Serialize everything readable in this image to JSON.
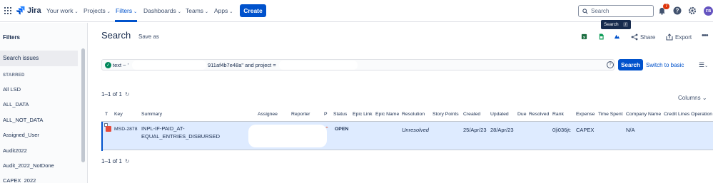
{
  "nav": {
    "logo": "Jira",
    "items": [
      {
        "label": "Your work"
      },
      {
        "label": "Projects"
      },
      {
        "label": "Filters"
      },
      {
        "label": "Dashboards"
      },
      {
        "label": "Teams"
      },
      {
        "label": "Apps"
      }
    ],
    "create": "Create",
    "search_placeholder": "Search",
    "tooltip": "Search",
    "tooltip_key": "/",
    "notifications": "7",
    "avatar": "FB"
  },
  "sidebar": {
    "title": "Filters",
    "selected": "Search issues",
    "starred_label": "STARRED",
    "items": [
      "All LSD",
      "ALL_DATA",
      "ALL_NOT_DATA",
      "Assigned_User",
      "Audit2022",
      "Audit_2022_NotDone",
      "CAPEX_2022"
    ]
  },
  "main": {
    "title": "Search",
    "save_as": "Save as",
    "share": "Share",
    "export": "Export",
    "jql_part1": "text ~ '",
    "jql_part2": "911af4b7e48a\" and project =",
    "search_btn": "Search",
    "switch_basic": "Switch to basic",
    "count": "1–1 of 1",
    "columns": "Columns"
  },
  "table": {
    "headers": [
      "T",
      "Key",
      "Summary",
      "Assignee",
      "Reporter",
      "P",
      "Status",
      "Epic Link",
      "Epic Name",
      "Resolution",
      "Story Points",
      "Created",
      "Updated",
      "Due",
      "Resolved",
      "Rank",
      "Expense",
      "Time Spent",
      "Company Name",
      "Credit Lines Operation"
    ],
    "row": {
      "key": "MSD-2878",
      "summary_line1": "INPL-IF-PAID_AT-",
      "summary_line2": "EQUAL_ENTRIES_DISBURSED",
      "status": "OPEN",
      "resolution": "Unresolved",
      "created": "25/Apr/23",
      "updated": "28/Apr/23",
      "rank": "0|i036jt:",
      "expense": "CAPEX",
      "company": "N/A"
    }
  },
  "colors": {
    "accent": "#0052cc",
    "selected_row": "#deebff",
    "badge": "#de350b"
  }
}
